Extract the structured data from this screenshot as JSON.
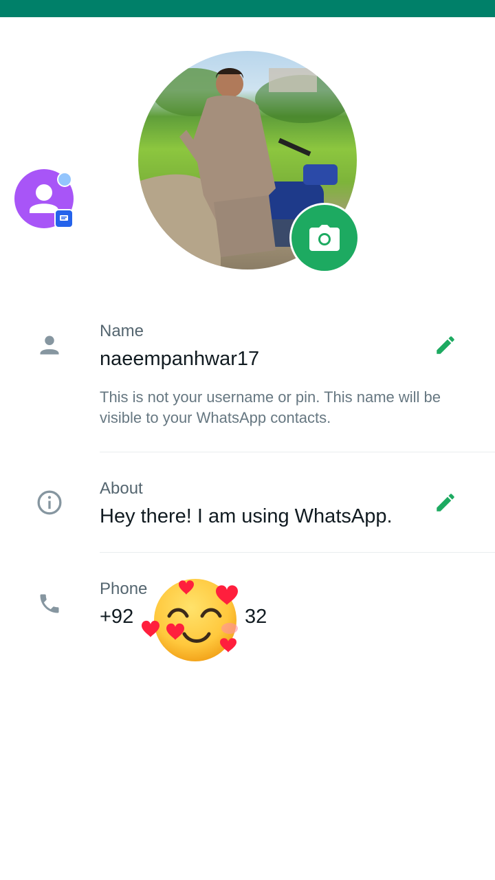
{
  "profile": {
    "name_label": "Name",
    "name_value": "naeempanhwar17",
    "name_hint": "This is not your username or pin. This name will be visible to your WhatsApp contacts.",
    "about_label": "About",
    "about_value": "Hey there! I am using WhatsApp.",
    "phone_label": "Phone",
    "phone_value_start": "+92",
    "phone_value_end": "32"
  },
  "icons": {
    "camera": "camera-icon",
    "person": "person-icon",
    "info": "info-icon",
    "phone": "phone-icon",
    "edit": "pencil-icon",
    "bubble": "contact-bubble-icon",
    "emoji": "smiling-face-with-hearts-emoji"
  },
  "colors": {
    "brand": "#008069",
    "accent": "#1daa61",
    "icon": "#8696a0"
  }
}
